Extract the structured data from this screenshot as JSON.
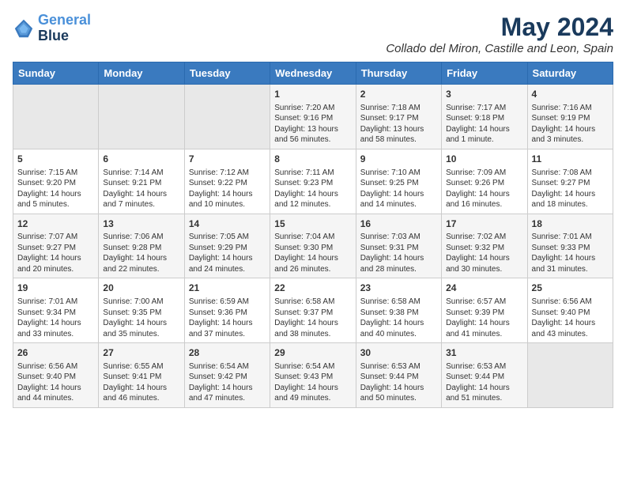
{
  "logo": {
    "line1": "General",
    "line2": "Blue"
  },
  "title": "May 2024",
  "subtitle": "Collado del Miron, Castille and Leon, Spain",
  "days_header": [
    "Sunday",
    "Monday",
    "Tuesday",
    "Wednesday",
    "Thursday",
    "Friday",
    "Saturday"
  ],
  "weeks": [
    [
      {
        "day": "",
        "content": ""
      },
      {
        "day": "",
        "content": ""
      },
      {
        "day": "",
        "content": ""
      },
      {
        "day": "1",
        "content": "Sunrise: 7:20 AM\nSunset: 9:16 PM\nDaylight: 13 hours and 56 minutes."
      },
      {
        "day": "2",
        "content": "Sunrise: 7:18 AM\nSunset: 9:17 PM\nDaylight: 13 hours and 58 minutes."
      },
      {
        "day": "3",
        "content": "Sunrise: 7:17 AM\nSunset: 9:18 PM\nDaylight: 14 hours and 1 minute."
      },
      {
        "day": "4",
        "content": "Sunrise: 7:16 AM\nSunset: 9:19 PM\nDaylight: 14 hours and 3 minutes."
      }
    ],
    [
      {
        "day": "5",
        "content": "Sunrise: 7:15 AM\nSunset: 9:20 PM\nDaylight: 14 hours and 5 minutes."
      },
      {
        "day": "6",
        "content": "Sunrise: 7:14 AM\nSunset: 9:21 PM\nDaylight: 14 hours and 7 minutes."
      },
      {
        "day": "7",
        "content": "Sunrise: 7:12 AM\nSunset: 9:22 PM\nDaylight: 14 hours and 10 minutes."
      },
      {
        "day": "8",
        "content": "Sunrise: 7:11 AM\nSunset: 9:23 PM\nDaylight: 14 hours and 12 minutes."
      },
      {
        "day": "9",
        "content": "Sunrise: 7:10 AM\nSunset: 9:25 PM\nDaylight: 14 hours and 14 minutes."
      },
      {
        "day": "10",
        "content": "Sunrise: 7:09 AM\nSunset: 9:26 PM\nDaylight: 14 hours and 16 minutes."
      },
      {
        "day": "11",
        "content": "Sunrise: 7:08 AM\nSunset: 9:27 PM\nDaylight: 14 hours and 18 minutes."
      }
    ],
    [
      {
        "day": "12",
        "content": "Sunrise: 7:07 AM\nSunset: 9:27 PM\nDaylight: 14 hours and 20 minutes."
      },
      {
        "day": "13",
        "content": "Sunrise: 7:06 AM\nSunset: 9:28 PM\nDaylight: 14 hours and 22 minutes."
      },
      {
        "day": "14",
        "content": "Sunrise: 7:05 AM\nSunset: 9:29 PM\nDaylight: 14 hours and 24 minutes."
      },
      {
        "day": "15",
        "content": "Sunrise: 7:04 AM\nSunset: 9:30 PM\nDaylight: 14 hours and 26 minutes."
      },
      {
        "day": "16",
        "content": "Sunrise: 7:03 AM\nSunset: 9:31 PM\nDaylight: 14 hours and 28 minutes."
      },
      {
        "day": "17",
        "content": "Sunrise: 7:02 AM\nSunset: 9:32 PM\nDaylight: 14 hours and 30 minutes."
      },
      {
        "day": "18",
        "content": "Sunrise: 7:01 AM\nSunset: 9:33 PM\nDaylight: 14 hours and 31 minutes."
      }
    ],
    [
      {
        "day": "19",
        "content": "Sunrise: 7:01 AM\nSunset: 9:34 PM\nDaylight: 14 hours and 33 minutes."
      },
      {
        "day": "20",
        "content": "Sunrise: 7:00 AM\nSunset: 9:35 PM\nDaylight: 14 hours and 35 minutes."
      },
      {
        "day": "21",
        "content": "Sunrise: 6:59 AM\nSunset: 9:36 PM\nDaylight: 14 hours and 37 minutes."
      },
      {
        "day": "22",
        "content": "Sunrise: 6:58 AM\nSunset: 9:37 PM\nDaylight: 14 hours and 38 minutes."
      },
      {
        "day": "23",
        "content": "Sunrise: 6:58 AM\nSunset: 9:38 PM\nDaylight: 14 hours and 40 minutes."
      },
      {
        "day": "24",
        "content": "Sunrise: 6:57 AM\nSunset: 9:39 PM\nDaylight: 14 hours and 41 minutes."
      },
      {
        "day": "25",
        "content": "Sunrise: 6:56 AM\nSunset: 9:40 PM\nDaylight: 14 hours and 43 minutes."
      }
    ],
    [
      {
        "day": "26",
        "content": "Sunrise: 6:56 AM\nSunset: 9:40 PM\nDaylight: 14 hours and 44 minutes."
      },
      {
        "day": "27",
        "content": "Sunrise: 6:55 AM\nSunset: 9:41 PM\nDaylight: 14 hours and 46 minutes."
      },
      {
        "day": "28",
        "content": "Sunrise: 6:54 AM\nSunset: 9:42 PM\nDaylight: 14 hours and 47 minutes."
      },
      {
        "day": "29",
        "content": "Sunrise: 6:54 AM\nSunset: 9:43 PM\nDaylight: 14 hours and 49 minutes."
      },
      {
        "day": "30",
        "content": "Sunrise: 6:53 AM\nSunset: 9:44 PM\nDaylight: 14 hours and 50 minutes."
      },
      {
        "day": "31",
        "content": "Sunrise: 6:53 AM\nSunset: 9:44 PM\nDaylight: 14 hours and 51 minutes."
      },
      {
        "day": "",
        "content": ""
      }
    ]
  ]
}
